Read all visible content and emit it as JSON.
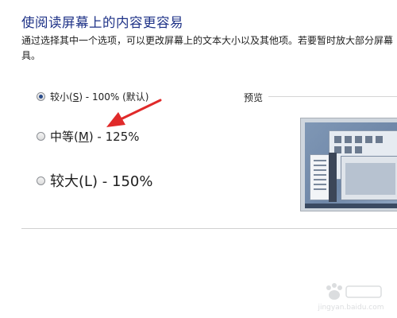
{
  "title": "使阅读屏幕上的内容更容易",
  "description": "通过选择其中一个选项，可以更改屏幕上的文本大小以及其他项。若要暂时放大部分屏幕具。",
  "options": [
    {
      "pre": "较小(",
      "key": "S",
      "post": ") - 100% (默认)",
      "checked": true
    },
    {
      "pre": "中等(",
      "key": "M",
      "post": ") - 125%",
      "checked": false
    },
    {
      "pre": "较大(L) - 150%",
      "key": "",
      "post": "",
      "checked": false
    }
  ],
  "preview_label": "预览",
  "watermark_text": "jingyan.baidu.com",
  "colors": {
    "title": "#1e3287",
    "arrow": "#e02a2a"
  }
}
